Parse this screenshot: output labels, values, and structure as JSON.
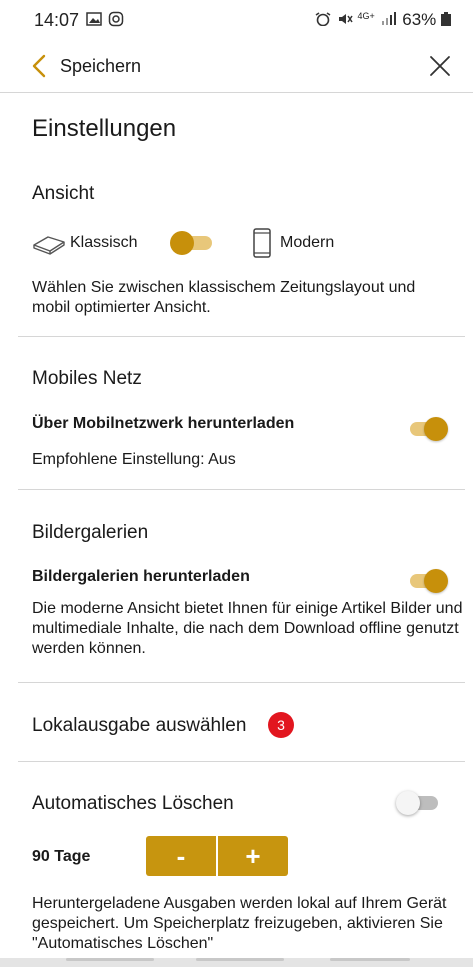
{
  "status_bar": {
    "time": "14:07",
    "battery": "63%",
    "network": "4G+"
  },
  "header": {
    "back_label": "Speichern",
    "icons": [
      "back-chevron-icon",
      "close-icon"
    ]
  },
  "page_title": "Einstellungen",
  "ansicht": {
    "title": "Ansicht",
    "option_classic": "Klassisch",
    "option_modern": "Modern",
    "description": "Wählen Sie zwischen klassischem Zeitungslayout und mobil optimierter Ansicht."
  },
  "mobiles_netz": {
    "title": "Mobiles Netz",
    "setting_label": "Über Mobilnetzwerk herunterladen",
    "recommendation": "Empfohlene Einstellung: Aus",
    "enabled": true
  },
  "bildergalerien": {
    "title": "Bildergalerien",
    "setting_label": "Bildergalerien herunterladen",
    "description": "Die moderne Ansicht bietet Ihnen für einige Artikel Bilder und multimediale Inhalte, die nach dem Download offline genutzt werden können.",
    "enabled": true
  },
  "lokalausgabe": {
    "title": "Lokalausgabe auswählen",
    "badge": "3"
  },
  "auto_delete": {
    "title": "Automatisches Löschen",
    "enabled": false,
    "days_label": "90 Tage",
    "minus": "-",
    "plus": "+",
    "description": "Heruntergeladene Ausgaben werden lokal auf Ihrem Gerät gespeichert. Um Speicherplatz freizugeben, aktivieren Sie \"Automatisches Löschen\""
  },
  "colors": {
    "accent": "#c7900b",
    "accent_light": "#e8c77a",
    "badge": "#e2161f",
    "divider": "#d6d6d6"
  }
}
